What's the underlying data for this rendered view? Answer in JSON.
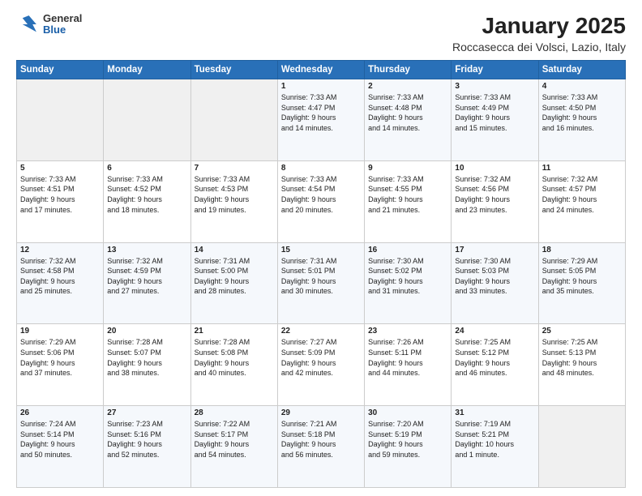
{
  "logo": {
    "general": "General",
    "blue": "Blue"
  },
  "header": {
    "month": "January 2025",
    "location": "Roccasecca dei Volsci, Lazio, Italy"
  },
  "weekdays": [
    "Sunday",
    "Monday",
    "Tuesday",
    "Wednesday",
    "Thursday",
    "Friday",
    "Saturday"
  ],
  "weeks": [
    [
      {
        "day": "",
        "info": ""
      },
      {
        "day": "",
        "info": ""
      },
      {
        "day": "",
        "info": ""
      },
      {
        "day": "1",
        "info": "Sunrise: 7:33 AM\nSunset: 4:47 PM\nDaylight: 9 hours\nand 14 minutes."
      },
      {
        "day": "2",
        "info": "Sunrise: 7:33 AM\nSunset: 4:48 PM\nDaylight: 9 hours\nand 14 minutes."
      },
      {
        "day": "3",
        "info": "Sunrise: 7:33 AM\nSunset: 4:49 PM\nDaylight: 9 hours\nand 15 minutes."
      },
      {
        "day": "4",
        "info": "Sunrise: 7:33 AM\nSunset: 4:50 PM\nDaylight: 9 hours\nand 16 minutes."
      }
    ],
    [
      {
        "day": "5",
        "info": "Sunrise: 7:33 AM\nSunset: 4:51 PM\nDaylight: 9 hours\nand 17 minutes."
      },
      {
        "day": "6",
        "info": "Sunrise: 7:33 AM\nSunset: 4:52 PM\nDaylight: 9 hours\nand 18 minutes."
      },
      {
        "day": "7",
        "info": "Sunrise: 7:33 AM\nSunset: 4:53 PM\nDaylight: 9 hours\nand 19 minutes."
      },
      {
        "day": "8",
        "info": "Sunrise: 7:33 AM\nSunset: 4:54 PM\nDaylight: 9 hours\nand 20 minutes."
      },
      {
        "day": "9",
        "info": "Sunrise: 7:33 AM\nSunset: 4:55 PM\nDaylight: 9 hours\nand 21 minutes."
      },
      {
        "day": "10",
        "info": "Sunrise: 7:32 AM\nSunset: 4:56 PM\nDaylight: 9 hours\nand 23 minutes."
      },
      {
        "day": "11",
        "info": "Sunrise: 7:32 AM\nSunset: 4:57 PM\nDaylight: 9 hours\nand 24 minutes."
      }
    ],
    [
      {
        "day": "12",
        "info": "Sunrise: 7:32 AM\nSunset: 4:58 PM\nDaylight: 9 hours\nand 25 minutes."
      },
      {
        "day": "13",
        "info": "Sunrise: 7:32 AM\nSunset: 4:59 PM\nDaylight: 9 hours\nand 27 minutes."
      },
      {
        "day": "14",
        "info": "Sunrise: 7:31 AM\nSunset: 5:00 PM\nDaylight: 9 hours\nand 28 minutes."
      },
      {
        "day": "15",
        "info": "Sunrise: 7:31 AM\nSunset: 5:01 PM\nDaylight: 9 hours\nand 30 minutes."
      },
      {
        "day": "16",
        "info": "Sunrise: 7:30 AM\nSunset: 5:02 PM\nDaylight: 9 hours\nand 31 minutes."
      },
      {
        "day": "17",
        "info": "Sunrise: 7:30 AM\nSunset: 5:03 PM\nDaylight: 9 hours\nand 33 minutes."
      },
      {
        "day": "18",
        "info": "Sunrise: 7:29 AM\nSunset: 5:05 PM\nDaylight: 9 hours\nand 35 minutes."
      }
    ],
    [
      {
        "day": "19",
        "info": "Sunrise: 7:29 AM\nSunset: 5:06 PM\nDaylight: 9 hours\nand 37 minutes."
      },
      {
        "day": "20",
        "info": "Sunrise: 7:28 AM\nSunset: 5:07 PM\nDaylight: 9 hours\nand 38 minutes."
      },
      {
        "day": "21",
        "info": "Sunrise: 7:28 AM\nSunset: 5:08 PM\nDaylight: 9 hours\nand 40 minutes."
      },
      {
        "day": "22",
        "info": "Sunrise: 7:27 AM\nSunset: 5:09 PM\nDaylight: 9 hours\nand 42 minutes."
      },
      {
        "day": "23",
        "info": "Sunrise: 7:26 AM\nSunset: 5:11 PM\nDaylight: 9 hours\nand 44 minutes."
      },
      {
        "day": "24",
        "info": "Sunrise: 7:25 AM\nSunset: 5:12 PM\nDaylight: 9 hours\nand 46 minutes."
      },
      {
        "day": "25",
        "info": "Sunrise: 7:25 AM\nSunset: 5:13 PM\nDaylight: 9 hours\nand 48 minutes."
      }
    ],
    [
      {
        "day": "26",
        "info": "Sunrise: 7:24 AM\nSunset: 5:14 PM\nDaylight: 9 hours\nand 50 minutes."
      },
      {
        "day": "27",
        "info": "Sunrise: 7:23 AM\nSunset: 5:16 PM\nDaylight: 9 hours\nand 52 minutes."
      },
      {
        "day": "28",
        "info": "Sunrise: 7:22 AM\nSunset: 5:17 PM\nDaylight: 9 hours\nand 54 minutes."
      },
      {
        "day": "29",
        "info": "Sunrise: 7:21 AM\nSunset: 5:18 PM\nDaylight: 9 hours\nand 56 minutes."
      },
      {
        "day": "30",
        "info": "Sunrise: 7:20 AM\nSunset: 5:19 PM\nDaylight: 9 hours\nand 59 minutes."
      },
      {
        "day": "31",
        "info": "Sunrise: 7:19 AM\nSunset: 5:21 PM\nDaylight: 10 hours\nand 1 minute."
      },
      {
        "day": "",
        "info": ""
      }
    ]
  ]
}
